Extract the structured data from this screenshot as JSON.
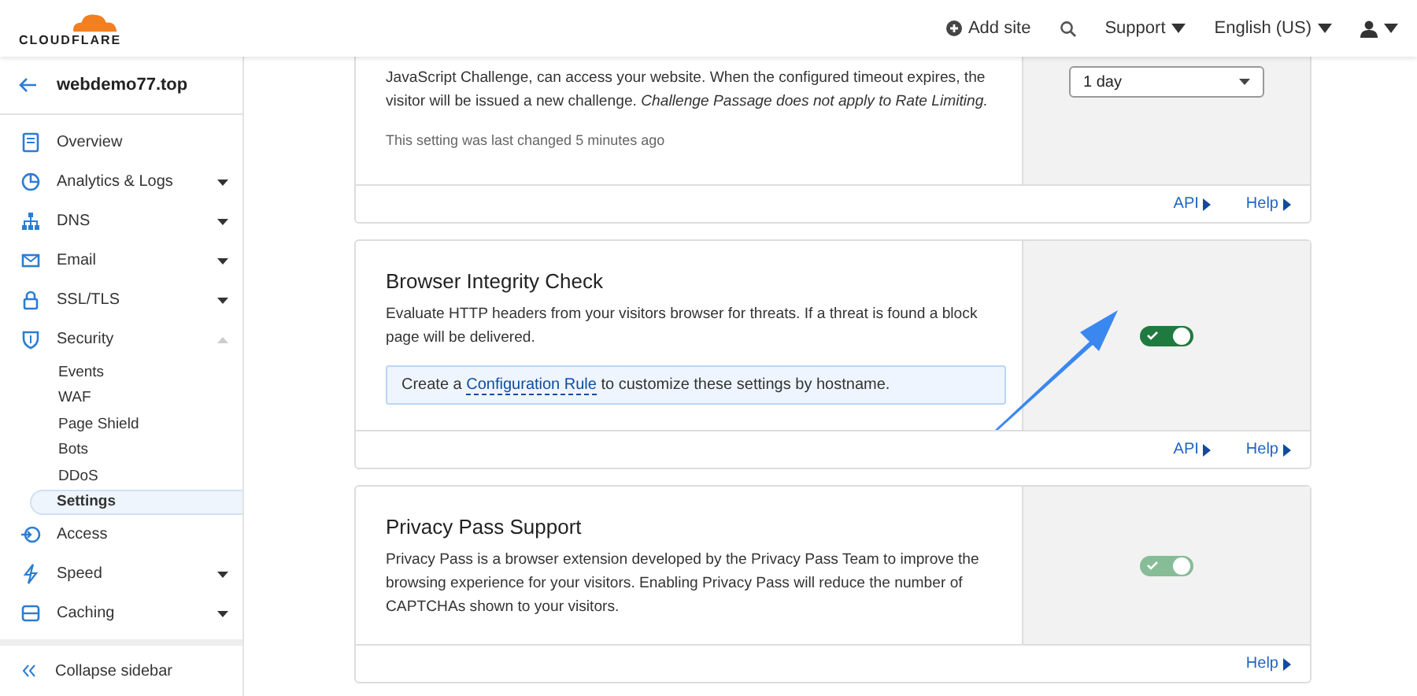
{
  "header": {
    "logo": "CLOUDFLARE",
    "add_site": "Add site",
    "support": "Support",
    "language": "English (US)"
  },
  "sidebar": {
    "domain": "webdemo77.top",
    "items": [
      {
        "label": "Overview"
      },
      {
        "label": "Analytics & Logs",
        "expanded": false
      },
      {
        "label": "DNS",
        "expanded": false
      },
      {
        "label": "Email",
        "expanded": false
      },
      {
        "label": "SSL/TLS",
        "expanded": false
      },
      {
        "label": "Security",
        "expanded": true,
        "children": [
          {
            "label": "Events",
            "selected": false
          },
          {
            "label": "WAF",
            "selected": false
          },
          {
            "label": "Page Shield",
            "selected": false
          },
          {
            "label": "Bots",
            "selected": false
          },
          {
            "label": "DDoS",
            "selected": false
          },
          {
            "label": "Settings",
            "selected": true
          }
        ]
      },
      {
        "label": "Access"
      },
      {
        "label": "Speed",
        "expanded": false
      },
      {
        "label": "Caching",
        "expanded": false
      }
    ],
    "collapse": "Collapse sidebar"
  },
  "cards": [
    {
      "kind": "select",
      "description": "JavaScript Challenge, can access your website. When the configured timeout expires, the visitor will be issued a new challenge. *Challenge Passage does not apply to Rate Limiting.*",
      "note": "This setting was last changed 5 minutes ago",
      "value": "1 day",
      "links": [
        "API",
        "Help"
      ]
    },
    {
      "kind": "toggle",
      "title": "Browser Integrity Check",
      "description": "Evaluate HTTP headers from your visitors browser for threats. If a threat is found a block page will be delivered.",
      "info": {
        "before": "Create a ",
        "link": "Configuration Rule",
        "after": " to customize these settings by hostname."
      },
      "on": true,
      "disabled": false,
      "links": [
        "API",
        "Help"
      ]
    },
    {
      "kind": "toggle",
      "title": "Privacy Pass Support",
      "description": "Privacy Pass is a browser extension developed by the Privacy Pass Team to improve the browsing experience for your visitors. Enabling Privacy Pass will reduce the number of CAPTCHAs shown to your visitors.",
      "on": true,
      "disabled": true,
      "links": [
        "Help"
      ]
    }
  ]
}
